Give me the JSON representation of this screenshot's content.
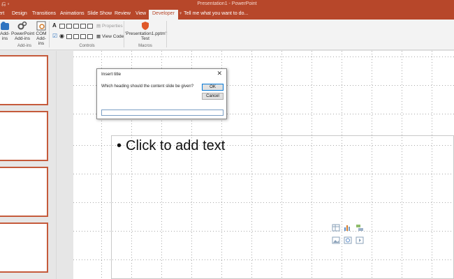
{
  "window": {
    "title": "Presentation1 - PowerPoint",
    "qat_icons": [
      "undo-icon",
      "redo-icon"
    ]
  },
  "tabs": [
    {
      "label": "ert",
      "active": false
    },
    {
      "label": "Design",
      "active": false
    },
    {
      "label": "Transitions",
      "active": false
    },
    {
      "label": "Animations",
      "active": false
    },
    {
      "label": "Slide Show",
      "active": false
    },
    {
      "label": "Review",
      "active": false
    },
    {
      "label": "View",
      "active": false
    },
    {
      "label": "Developer",
      "active": true
    }
  ],
  "tell_me": "Tell me what you want to do...",
  "ribbon": {
    "addins": {
      "addins_label_line1": "Add-",
      "addins_label_line2": "ins",
      "ppt_addins_line1": "PowerPoint",
      "ppt_addins_line2": "Add-ins",
      "com_addins_line1": "COM",
      "com_addins_line2": "Add-ins",
      "group_label": "Add-ins"
    },
    "controls": {
      "properties_label": "Properties",
      "view_code_label": "View Code",
      "group_label": "Controls"
    },
    "macros": {
      "macro_line1": "'Presentation1.pptm'!",
      "macro_line2": "Test",
      "group_label": "Macros"
    }
  },
  "slide": {
    "content_placeholder": "Click to add text",
    "bullet": "•"
  },
  "dialog": {
    "title": "Insert title",
    "close": "✕",
    "prompt": "Which heading should the content slide be given?",
    "ok_label": "OK",
    "cancel_label": "Cancel",
    "input_value": ""
  },
  "colors": {
    "accent": "#b7472a",
    "ribbon_bg": "#f3f3f3",
    "thumb_border": "#c55a3b"
  }
}
